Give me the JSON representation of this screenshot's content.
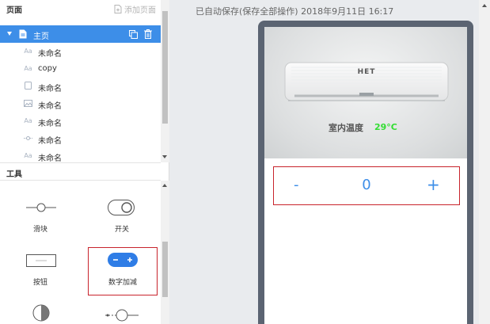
{
  "sidebar": {
    "pages_title": "页面",
    "add_page_label": "添加页面",
    "home": {
      "label": "主页"
    },
    "items": [
      {
        "icon": "text-icon",
        "glyph": "Aa",
        "label": "未命名"
      },
      {
        "icon": "text-icon",
        "glyph": "Aa",
        "label": "copy"
      },
      {
        "icon": "rectangle-icon",
        "glyph": "",
        "label": "未命名"
      },
      {
        "icon": "image-icon",
        "glyph": "",
        "label": "未命名"
      },
      {
        "icon": "text-icon",
        "glyph": "Aa",
        "label": "未命名"
      },
      {
        "icon": "slider-icon",
        "glyph": "",
        "label": "未命名"
      },
      {
        "icon": "text-icon",
        "glyph": "Aa",
        "label": "未命名"
      }
    ],
    "tools_title": "工具",
    "tools": [
      {
        "icon": "slider-icon",
        "label": "滑块"
      },
      {
        "icon": "toggle-icon",
        "label": "开关"
      },
      {
        "icon": "button-icon",
        "label": "按钮"
      },
      {
        "icon": "stepper-icon",
        "label": "数字加减"
      },
      {
        "icon": "gauge-icon",
        "label": ""
      },
      {
        "icon": "knob-slider-icon",
        "label": ""
      }
    ]
  },
  "header": {
    "save_status": "已自动保存(保存全部操作) 2018年9月11日 16:17"
  },
  "preview": {
    "ac_brand": "HET",
    "temp_label": "室内温度",
    "temp_value": "29°C",
    "stepper": {
      "minus": "-",
      "value": "0",
      "plus": "+"
    }
  },
  "colors": {
    "accent": "#3d8ee8",
    "highlight_border": "#c8232c",
    "temp_green": "#33dd33",
    "phone_frame": "#5b6472"
  }
}
